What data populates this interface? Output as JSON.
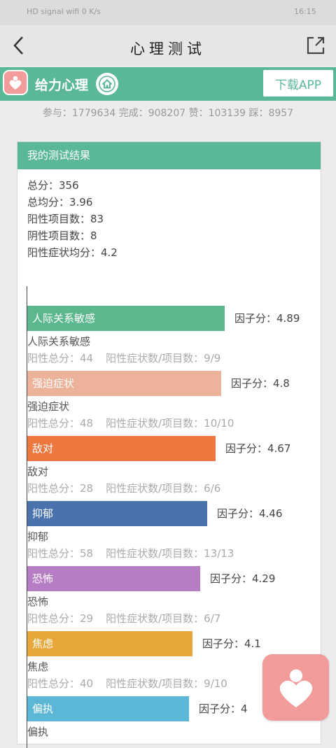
{
  "status_bar": {
    "left_icons": "HD signal wifi 0 K/s",
    "time": "16:15"
  },
  "header": {
    "title": "心理测试"
  },
  "brand": {
    "name": "给力心理",
    "download_label": "下载APP"
  },
  "stats_line": "参与：1779634 完成：908207 赞：103139 踩：8957",
  "result_card": {
    "heading": "我的测试结果",
    "summary": [
      "总分：356",
      "总均分：3.96",
      "阳性项目数：83",
      "阴性项目数：8",
      "阳性症状均分：4.2"
    ]
  },
  "chart_data": {
    "type": "bar",
    "orientation": "horizontal",
    "categories": [
      "人际关系敏感",
      "强迫症状",
      "敌对",
      "抑郁",
      "恐怖",
      "焦虑",
      "偏执"
    ],
    "values": [
      4.89,
      4.8,
      4.67,
      4.46,
      4.29,
      4.1,
      4
    ],
    "value_prefix": "因子分：",
    "colors": [
      "#5ab88c",
      "#ecb39a",
      "#ec7840",
      "#4a73ad",
      "#b77dc4",
      "#e8a73a",
      "#5cb6d6"
    ],
    "details": [
      {
        "positive_total": "阳性总分：44",
        "ratio": "阳性症状数/项目数：9/9"
      },
      {
        "positive_total": "阳性总分：48",
        "ratio": "阳性症状数/项目数：10/10"
      },
      {
        "positive_total": "阳性总分：28",
        "ratio": "阳性症状数/项目数：6/6"
      },
      {
        "positive_total": "阳性总分：58",
        "ratio": "阳性症状数/项目数：13/13"
      },
      {
        "positive_total": "阳性总分：29",
        "ratio": "阳性症状数/项目数：6/7"
      },
      {
        "positive_total": "阳性总分：40",
        "ratio": "阳性症状数/项目数：9/10"
      },
      {
        "positive_total": "",
        "ratio": ""
      }
    ],
    "xlim": [
      0,
      5.5
    ]
  },
  "icons": [
    "back-arrow-icon",
    "share-icon",
    "heart-logo-icon",
    "home-icon"
  ]
}
